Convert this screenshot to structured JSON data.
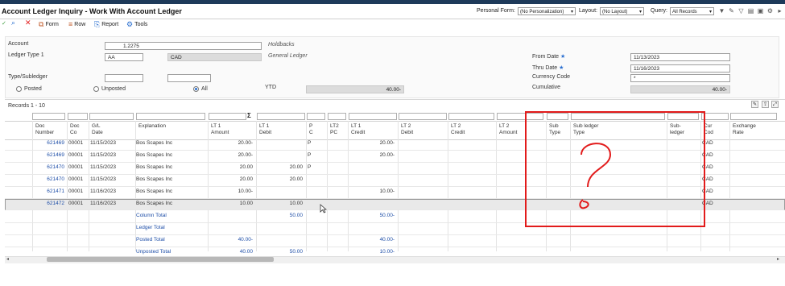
{
  "app": {
    "title": "Account Ledger Inquiry - Work With Account Ledger",
    "personal_form_label": "Personal Form:",
    "personal_form_value": "(No Personalization)",
    "layout_label": "Layout:",
    "layout_value": "(No Layout)",
    "query_label": "Query:",
    "query_value": "All Records"
  },
  "toolbar": {
    "form": "Form",
    "row": "Row",
    "report": "Report",
    "tools": "Tools"
  },
  "header": {
    "account_label": "Account",
    "account_value": "1.2275",
    "account_desc": "Holdbacks",
    "ledger_type_label": "Ledger Type 1",
    "ledger_type_value": "AA",
    "ledger_currency": "CAD",
    "ledger_desc": "General Ledger",
    "type_subledger_label": "Type/Subledger",
    "posted_label": "Posted",
    "unposted_label": "Unposted",
    "all_label": "All",
    "ytd_label": "YTD",
    "ytd_value": "40.00-",
    "from_date_label": "From Date",
    "from_date_value": "11/13/2023",
    "thru_date_label": "Thru Date",
    "thru_date_value": "11/16/2023",
    "currency_code_label": "Currency Code",
    "currency_code_value": "*",
    "cumulative_label": "Cumulative",
    "cumulative_value": "40.00-"
  },
  "grid": {
    "records": "Records 1 - 10",
    "sum_icon": "Σ",
    "columns": [
      "Doc\nNumber",
      "Doc\nCo",
      "G/L\nDate",
      "Explanation",
      "LT 1\nAmount",
      "LT 1\nDebit",
      "P\nC",
      "LT2\nPC",
      "LT 1\nCredit",
      "LT 2\nDebit",
      "LT 2\nCredit",
      "LT 2\nAmount",
      "Sub\nType",
      "Sub ledger\nType",
      "Sub-\nledger",
      "Cur\nCod",
      "Exchange\nRate"
    ],
    "rows": [
      {
        "doc": "621469",
        "co": "00001",
        "date": "11/15/2023",
        "expl": "Bos Scapes Inc",
        "amt": "20.00-",
        "debit": "",
        "pc": "P",
        "credit": "20.00-",
        "cur": "CAD"
      },
      {
        "doc": "621469",
        "co": "00001",
        "date": "11/15/2023",
        "expl": "Bos Scapes Inc",
        "amt": "20.00-",
        "debit": "",
        "pc": "P",
        "credit": "20.00-",
        "cur": "CAD"
      },
      {
        "doc": "621470",
        "co": "00001",
        "date": "11/15/2023",
        "expl": "Bos Scapes Inc",
        "amt": "20.00",
        "debit": "20.00",
        "pc": "P",
        "credit": "",
        "cur": "CAD"
      },
      {
        "doc": "621470",
        "co": "00001",
        "date": "11/15/2023",
        "expl": "Bos Scapes Inc",
        "amt": "20.00",
        "debit": "20.00",
        "pc": "",
        "credit": "",
        "cur": "CAD"
      },
      {
        "doc": "621471",
        "co": "00001",
        "date": "11/16/2023",
        "expl": "Bos Scapes Inc",
        "amt": "10.00-",
        "debit": "",
        "pc": "",
        "credit": "10.00-",
        "cur": "CAD"
      },
      {
        "doc": "621472",
        "co": "00001",
        "date": "11/16/2023",
        "expl": "Bos Scapes Inc",
        "amt": "10.00",
        "debit": "10.00",
        "pc": "",
        "credit": "",
        "cur": "CAD"
      }
    ],
    "totals": [
      {
        "label": "Column Total",
        "amt": "",
        "debit": "50.00",
        "credit": "50.00-"
      },
      {
        "label": "Ledger Total",
        "amt": "",
        "debit": "",
        "credit": ""
      },
      {
        "label": "Posted Total",
        "amt": "40.00-",
        "debit": "",
        "credit": "40.00-"
      },
      {
        "label": "Unposted Total",
        "amt": "40.00",
        "debit": "50.00",
        "credit": "10.00-"
      }
    ]
  },
  "colors": {
    "accent": "#1f4fa8",
    "annotation": "#e21b1b",
    "header_bar": "#1e3a5a"
  }
}
